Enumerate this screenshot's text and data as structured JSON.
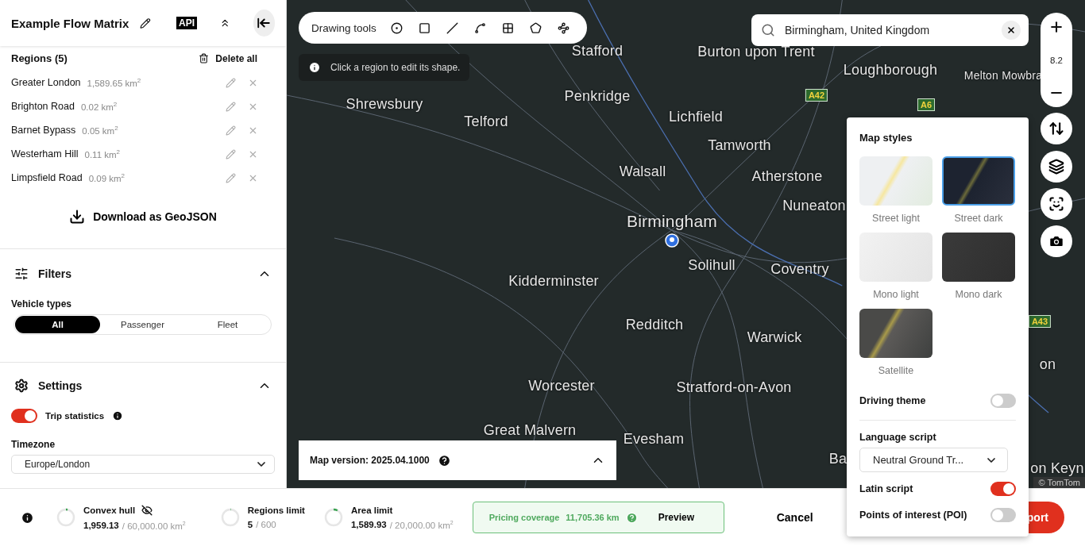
{
  "header": {
    "title": "Example Flow Matrix",
    "api_badge": "API"
  },
  "regions": {
    "title": "Regions (5)",
    "delete_all": "Delete all",
    "download": "Download as GeoJSON",
    "items": [
      {
        "name": "Greater London",
        "area": "1,589.65 km$^{2}$"
      },
      {
        "name": "Brighton Road",
        "area": "0.02 km$^{2}$"
      },
      {
        "name": "Barnet Bypass",
        "area": "0.05 km$^{2}$"
      },
      {
        "name": "Westerham Hill",
        "area": "0.11 km$^{2}$"
      },
      {
        "name": "Limpsfield Road",
        "area": "0.09 km$^{2}$"
      }
    ]
  },
  "filters": {
    "title": "Filters",
    "expanded": true,
    "vehicle_types": {
      "label": "Vehicle types",
      "options": [
        {
          "label": "All",
          "selected": true
        },
        {
          "label": "Passenger",
          "selected": false
        },
        {
          "label": "Fleet",
          "selected": false
        }
      ]
    }
  },
  "settings": {
    "title": "Settings",
    "expanded": true,
    "trip_statistics": {
      "label": "Trip statistics",
      "on": true
    },
    "timezone": {
      "label": "Timezone",
      "value": "Europe/London"
    }
  },
  "map": {
    "drawing_tools": "Drawing tools",
    "hint": "Click a region to edit its shape.",
    "search": {
      "value": "Birmingham, United Kingdom"
    },
    "zoom": "8.2",
    "attribution": "© TomTom",
    "map_version": {
      "text": "Map version: 2025.04.1000",
      "expanded": false
    },
    "labels": [
      {
        "text": "Stafford",
        "kind": "city"
      },
      {
        "text": "Burton upon Trent",
        "kind": "city"
      },
      {
        "text": "Loughborough",
        "kind": "city"
      },
      {
        "text": "Melton Mowbra",
        "kind": "town"
      },
      {
        "text": "Shrewsbury",
        "kind": "city"
      },
      {
        "text": "Penkridge",
        "kind": "city"
      },
      {
        "text": "Telford",
        "kind": "city"
      },
      {
        "text": "Lichfield",
        "kind": "city"
      },
      {
        "text": "Tamworth",
        "kind": "city"
      },
      {
        "text": "Walsall",
        "kind": "city"
      },
      {
        "text": "Atherstone",
        "kind": "city"
      },
      {
        "text": "Nuneaton",
        "kind": "city"
      },
      {
        "text": "Birmingham",
        "kind": "capital"
      },
      {
        "text": "Solihull",
        "kind": "city"
      },
      {
        "text": "Coventry",
        "kind": "city"
      },
      {
        "text": "Kidderminster",
        "kind": "city"
      },
      {
        "text": "Redditch",
        "kind": "city"
      },
      {
        "text": "Warwick",
        "kind": "city"
      },
      {
        "text": "Worcester",
        "kind": "city"
      },
      {
        "text": "Stratford-on-Avon",
        "kind": "city"
      },
      {
        "text": "Great Malvern",
        "kind": "city"
      },
      {
        "text": "Evesham",
        "kind": "city"
      },
      {
        "text": "Ba",
        "kind": "city"
      },
      {
        "text": "on",
        "kind": "city"
      },
      {
        "text": "on Keyn",
        "kind": "city"
      },
      {
        "text": "A42",
        "kind": "road"
      },
      {
        "text": "A6",
        "kind": "road"
      },
      {
        "text": "A43",
        "kind": "road"
      }
    ]
  },
  "map_styles": {
    "title": "Map styles",
    "styles": [
      {
        "name": "Street light",
        "kind": "street-light",
        "selected": false
      },
      {
        "name": "Street dark",
        "kind": "street-dark",
        "selected": true
      },
      {
        "name": "Mono light",
        "kind": "mono-light",
        "selected": false
      },
      {
        "name": "Mono dark",
        "kind": "mono-dark",
        "selected": false
      },
      {
        "name": "Satellite",
        "kind": "satellite",
        "selected": false
      }
    ],
    "driving_theme": {
      "label": "Driving theme",
      "on": false
    },
    "language_script": {
      "label": "Language script",
      "value": "Neutral Ground Tr..."
    },
    "latin_script": {
      "label": "Latin script",
      "on": true
    },
    "poi": {
      "label": "Points of interest (POI)",
      "on": false
    }
  },
  "bottom_bar": {
    "stats": [
      {
        "label": "Convex hull",
        "value": "1,959.13",
        "limit": "/ 60,000.00 km$^{2}$",
        "level": 0.033,
        "visible": false
      },
      {
        "label": "Regions limit",
        "value": "5",
        "limit": "/ 600",
        "level": 0.008
      },
      {
        "label": "Area limit",
        "value": "1,589.93",
        "limit": "/ 20,000.00 km$^{2}$",
        "level": 0.08
      }
    ],
    "pricing": {
      "label": "Pricing coverage",
      "value": "11,705.36 km",
      "action": "Preview"
    },
    "cancel": "Cancel",
    "export": "port"
  }
}
